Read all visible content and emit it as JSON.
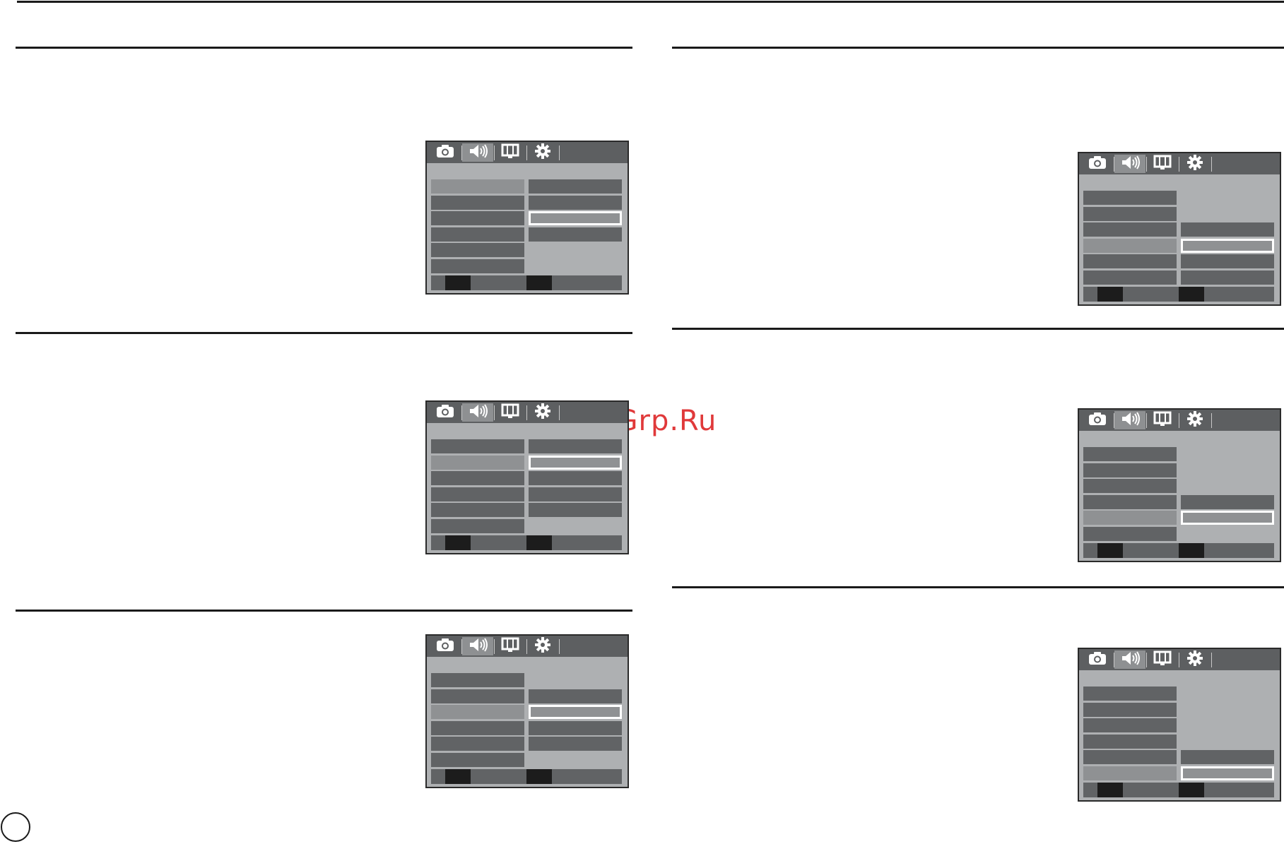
{
  "watermark": "McGrp.Ru",
  "tab_icons": [
    "camera-icon",
    "speaker-icon",
    "display-icon",
    "gear-icon"
  ],
  "screens": [
    {
      "id": "left-1",
      "selected_menu": 0,
      "options": 4,
      "selected_option": 2
    },
    {
      "id": "left-2",
      "selected_menu": 1,
      "options": 5,
      "selected_option": 1
    },
    {
      "id": "left-3",
      "selected_menu": 2,
      "options": 4,
      "selected_option": 1
    },
    {
      "id": "right-1",
      "selected_menu": 3,
      "options": 4,
      "selected_option": 1
    },
    {
      "id": "right-2",
      "selected_menu": 4,
      "options": 2,
      "selected_option": 1
    },
    {
      "id": "right-3",
      "selected_menu": 5,
      "options": 2,
      "selected_option": 1
    }
  ],
  "colors": {
    "lcd_bg": "#aeb0b2",
    "lcd_bar": "#5d5f61",
    "item": "#616365",
    "item_selected": "#8f9193",
    "highlight_border": "#ffffff",
    "watermark": "#e0393a"
  }
}
